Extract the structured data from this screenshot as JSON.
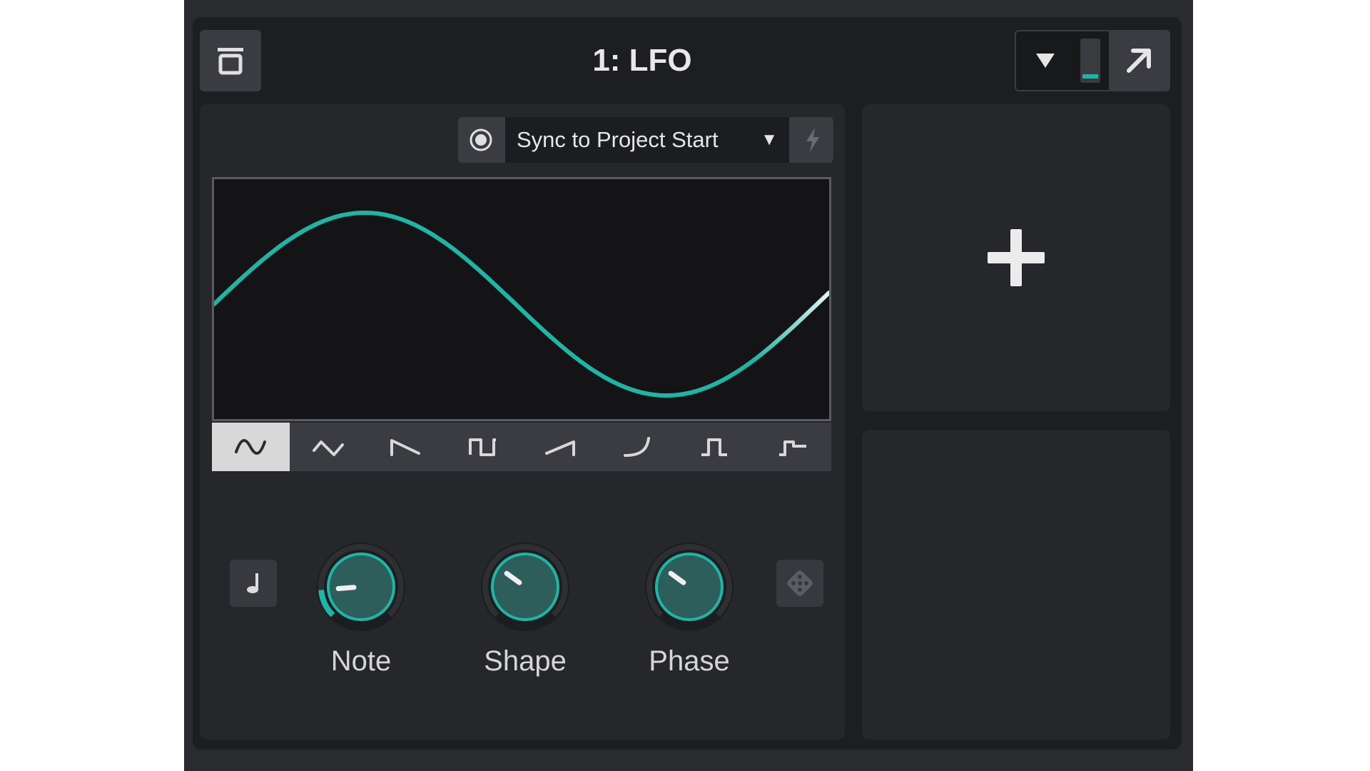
{
  "header": {
    "title": "1: LFO",
    "collapse_icon": "collapse-panel-icon",
    "dropdown_icon": "triangle-down-icon",
    "popout_icon": "arrow-up-right-icon",
    "meter_level": 0.1
  },
  "sync": {
    "mode_label": "Sync to Project Start",
    "radio_icon": "radio-target-icon",
    "trigger_icon": "lightning-icon"
  },
  "waveform": {
    "shape": "sine",
    "color": "#1fb5a5",
    "shapes": [
      "sine",
      "triangle",
      "ramp-down",
      "square",
      "ramp-up",
      "log-curve",
      "pulse",
      "step"
    ],
    "active_index": 0
  },
  "controls": {
    "note_toggle_icon": "music-note-icon",
    "randomize_icon": "dice-icon",
    "knobs": [
      {
        "label": "Note",
        "value": 0.15,
        "arc": true
      },
      {
        "label": "Shape",
        "value": 0.3,
        "arc": false
      },
      {
        "label": "Phase",
        "value": 0.3,
        "arc": false
      }
    ]
  },
  "slots": {
    "add_icon": "plus-icon"
  },
  "colors": {
    "accent": "#1fb5a5",
    "panel": "#26272b",
    "background": "#1d1e21"
  }
}
